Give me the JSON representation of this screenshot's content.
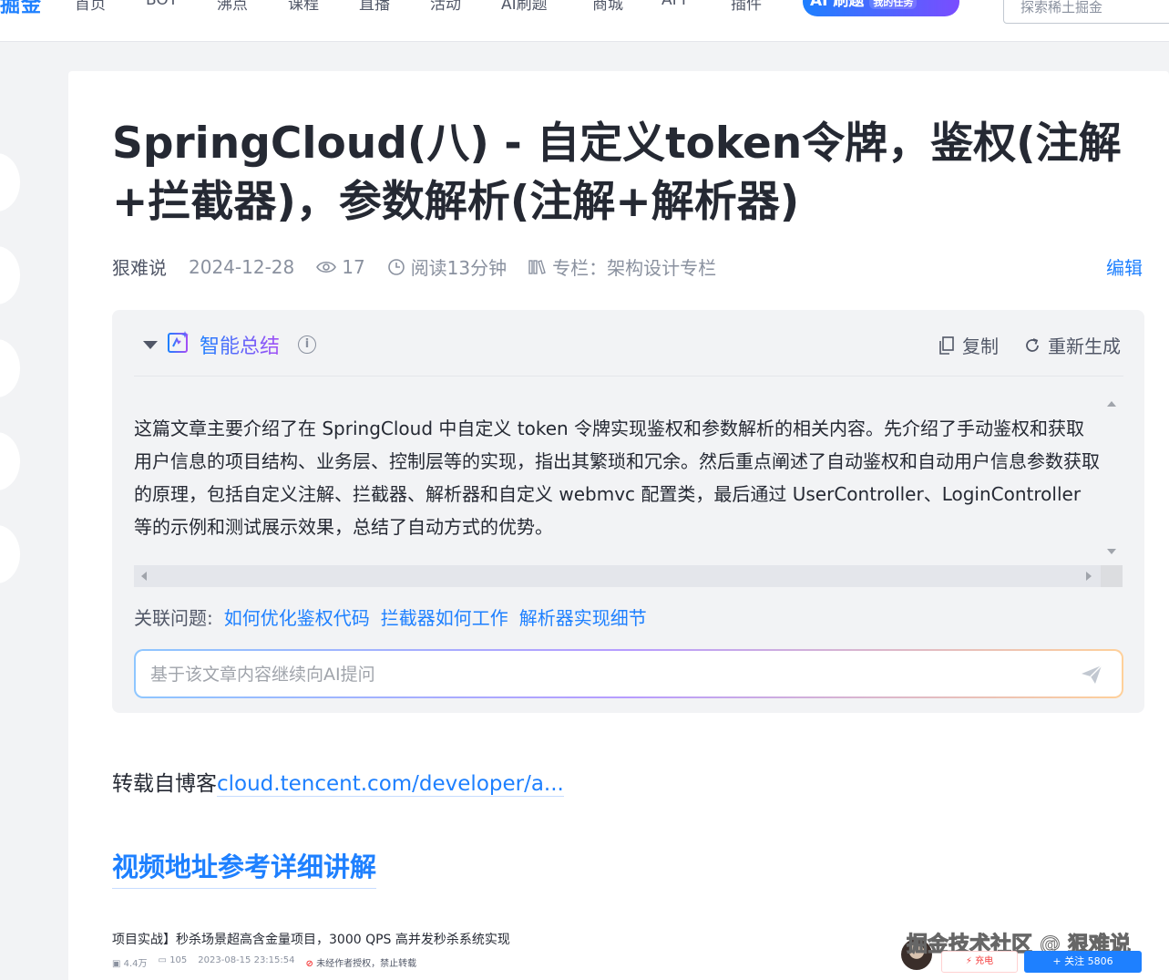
{
  "nav": {
    "logo": "掘金",
    "links": [
      "首页",
      "BOT",
      "沸点",
      "课程",
      "直播",
      "活动",
      "AI刷题",
      "商城",
      "APP",
      "插件"
    ],
    "ai_badge": "AI 刷题",
    "ai_badge_sub": "我的任务",
    "search_placeholder": "探索稀土掘金"
  },
  "article": {
    "title": "SpringCloud(八) - 自定义token令牌，鉴权(注解+拦截器)，参数解析(注解+解析器)",
    "author": "狠难说",
    "date": "2024-12-28",
    "views": "17",
    "read_time": "阅读13分钟",
    "column_label": "专栏：",
    "column_name": "架构设计专栏",
    "edit_label": "编辑"
  },
  "summary": {
    "title": "智能总结",
    "info": "i",
    "copy_label": "复制",
    "regen_label": "重新生成",
    "text": "这篇文章主要介绍了在 SpringCloud 中自定义 token 令牌实现鉴权和参数解析的相关内容。先介绍了手动鉴权和获取用户信息的项目结构、业务层、控制层等的实现，指出其繁琐和冗余。然后重点阐述了自动鉴权和自动用户信息参数获取的原理，包括自定义注解、拦截器、解析器和自定义 webmvc 配置类，最后通过 UserController、LoginController 等的示例和测试展示效果，总结了自动方式的优势。",
    "related_label": "关联问题:",
    "related": [
      "如何优化鉴权代码",
      "拦截器如何工作",
      "解析器实现细节"
    ],
    "ask_placeholder": "基于该文章内容继续向AI提问"
  },
  "body": {
    "repost_prefix": "转载自博客",
    "repost_link": "cloud.tencent.com/developer/a...",
    "heading": "视频地址参考详细讲解",
    "video_title": "项目实战】秒杀场景超高含金量项目，3000 QPS 高并发秒杀系统实现",
    "video_plays": "4.4万",
    "video_comments": "105",
    "video_time": "2023-08-15 23:15:54",
    "video_warn": "未经作者授权，禁止转载"
  },
  "footer": {
    "watermark": "掘金技术社区 @ 狠难说",
    "charge_label": "充电",
    "follow_label": "+ 关注 5806"
  }
}
